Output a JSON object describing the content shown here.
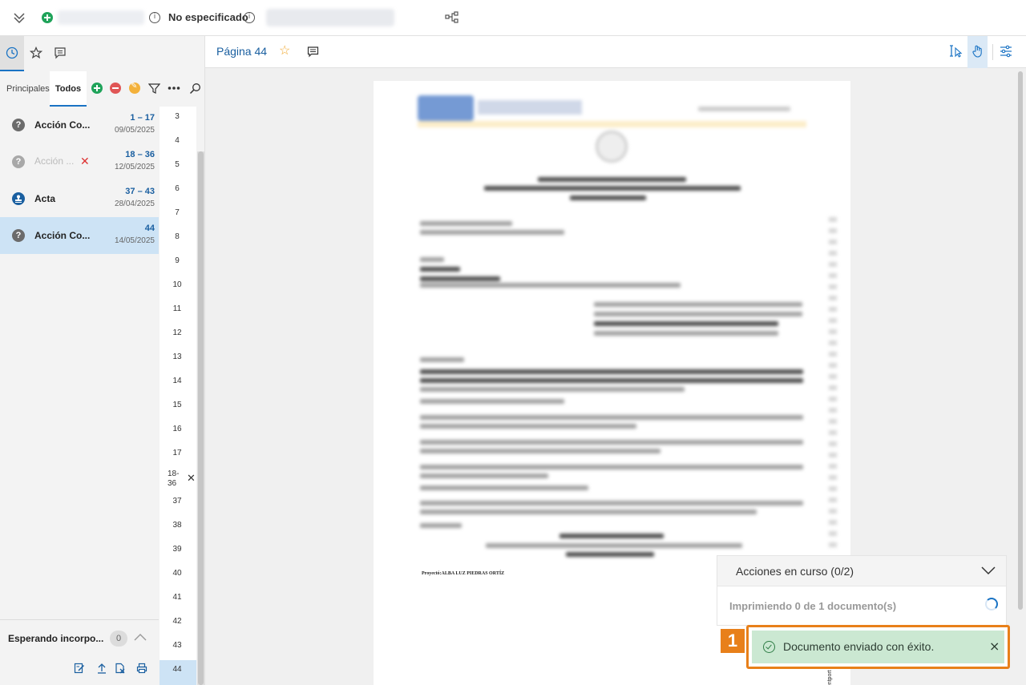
{
  "topbar": {
    "status_label": "No especificado",
    "icons": [
      "chevrons-down-icon",
      "add-circle-icon",
      "info-icon",
      "info-icon",
      "tree-structure-icon"
    ]
  },
  "left_panel": {
    "tabs": [
      {
        "icon": "clock-icon",
        "active": true
      },
      {
        "icon": "star-icon",
        "active": false
      },
      {
        "icon": "comment-icon",
        "active": false
      }
    ],
    "filter_tabs": [
      {
        "label": "Principales",
        "active": false
      },
      {
        "label": "Todos",
        "active": true
      }
    ],
    "documents": [
      {
        "name": "Acción Co...",
        "range": "1 – 17",
        "date": "09/05/2025",
        "icon": "question-icon",
        "faded": false,
        "selected": false
      },
      {
        "name": "Acción ...",
        "range": "18 – 36",
        "date": "12/05/2025",
        "icon": "question-icon",
        "faded": true,
        "selected": false,
        "removed_mark": "✕"
      },
      {
        "name": "Acta",
        "range": "37 – 43",
        "date": "28/04/2025",
        "icon": "stamp-icon",
        "faded": false,
        "selected": false
      },
      {
        "name": "Acción Co...",
        "range": "44",
        "date": "14/05/2025",
        "icon": "question-icon",
        "faded": false,
        "selected": true
      }
    ],
    "page_numbers": [
      "3",
      "4",
      "5",
      "6",
      "7",
      "8",
      "9",
      "10",
      "11",
      "12",
      "13",
      "14",
      "15",
      "16",
      "17",
      "18-\n36",
      "37",
      "38",
      "39",
      "40",
      "41",
      "42",
      "43",
      "44"
    ],
    "range_remove_mark": "✕",
    "waiting": {
      "label": "Esperando incorpo...",
      "count": "0"
    }
  },
  "main": {
    "page_title": "Página 44",
    "document_footer": "Proyectó:ALBA LUZ PIEDRAS ORTÍZ",
    "vertical_text": "mentport"
  },
  "actions_panel": {
    "title": "Acciones en curso (0/2)",
    "status": "Imprimiendo 0 de 1 documento(s)"
  },
  "toast": {
    "message": "Documento enviado con éxito.",
    "close": "×",
    "badge": "1"
  },
  "colors": {
    "accent": "#1a73c4",
    "selected_bg": "#cde3f5",
    "toast_bg": "#cbe8d2",
    "highlight": "#e8801a"
  }
}
